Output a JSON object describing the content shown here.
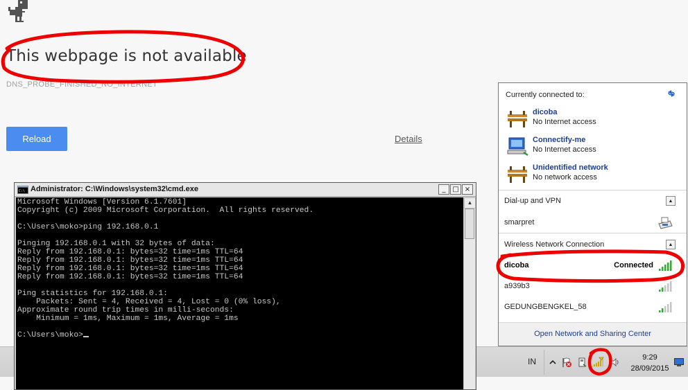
{
  "error_page": {
    "title": "This webpage is not available",
    "error_code": "DNS_PROBE_FINISHED_NO_INTERNET",
    "reload_label": "Reload",
    "details_label": "Details"
  },
  "cmd_window": {
    "title": "Administrator: C:\\Windows\\system32\\cmd.exe",
    "minimize_glyph": "_",
    "maximize_glyph": "□",
    "close_glyph": "×",
    "console_lines": [
      "Microsoft Windows [Version 6.1.7601]",
      "Copyright (c) 2009 Microsoft Corporation.  All rights reserved.",
      "",
      "C:\\Users\\moko>ping 192.168.0.1",
      "",
      "Pinging 192.168.0.1 with 32 bytes of data:",
      "Reply from 192.168.0.1: bytes=32 time=1ms TTL=64",
      "Reply from 192.168.0.1: bytes=32 time=1ms TTL=64",
      "Reply from 192.168.0.1: bytes=32 time=1ms TTL=64",
      "Reply from 192.168.0.1: bytes=32 time=1ms TTL=64",
      "",
      "Ping statistics for 192.168.0.1:",
      "    Packets: Sent = 4, Received = 4, Lost = 0 (0% loss),",
      "Approximate round trip times in milli-seconds:",
      "    Minimum = 1ms, Maximum = 1ms, Average = 1ms",
      "",
      "C:\\Users\\moko>"
    ]
  },
  "network_panel": {
    "header": "Currently connected to:",
    "connections": [
      {
        "name": "dicoba",
        "status": "No Internet access",
        "icon": "bench-network-icon"
      },
      {
        "name": "Connectify-me",
        "status": "No Internet access",
        "icon": "computer-network-icon"
      },
      {
        "name": "Unidentified network",
        "status": "No network access",
        "icon": "bench-network-icon"
      }
    ],
    "dialup_label": "Dial-up and VPN",
    "dialup_items": [
      {
        "name": "smarpret",
        "icon": "modem-icon"
      }
    ],
    "wireless_label": "Wireless Network Connection",
    "wireless_items": [
      {
        "name": "dicoba",
        "status": "Connected",
        "signal_bars": 5
      },
      {
        "name": "a939b3",
        "status": "",
        "signal_bars": 2
      },
      {
        "name": "GEDUNGBENGKEL_58",
        "status": "",
        "signal_bars": 2
      }
    ],
    "footer_link": "Open Network and Sharing Center"
  },
  "taskbar": {
    "language": "IN",
    "time": "9:29",
    "date": "28/09/2015",
    "tray_icons": [
      "show-hidden-icons-arrow",
      "action-center-flag-icon",
      "removable-device-icon",
      "wireless-signal-icon",
      "volume-icon"
    ]
  },
  "colors": {
    "reload_button": "#4b8cf0",
    "link_blue": "#1c3f94",
    "signal_green": "#3aa63a",
    "annotation_red": "#ee0000"
  }
}
